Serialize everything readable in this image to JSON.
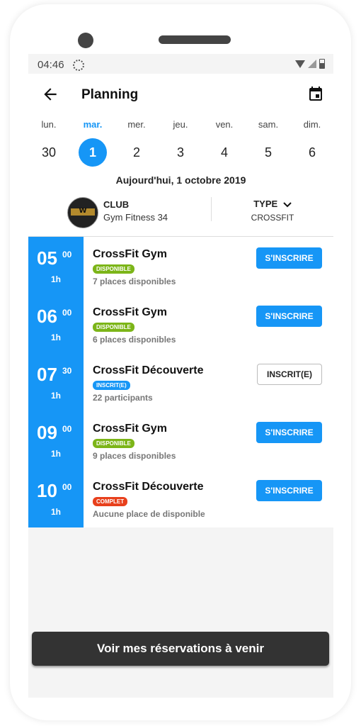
{
  "status": {
    "time": "04:46"
  },
  "header": {
    "title": "Planning"
  },
  "days": [
    {
      "label": "lun.",
      "num": "30",
      "active": false
    },
    {
      "label": "mar.",
      "num": "1",
      "active": true
    },
    {
      "label": "mer.",
      "num": "2",
      "active": false
    },
    {
      "label": "jeu.",
      "num": "3",
      "active": false
    },
    {
      "label": "ven.",
      "num": "4",
      "active": false
    },
    {
      "label": "sam.",
      "num": "5",
      "active": false
    },
    {
      "label": "dim.",
      "num": "6",
      "active": false
    }
  ],
  "date_line": "Aujourd'hui, 1 octobre 2019",
  "filters": {
    "club_label": "CLUB",
    "club_name": "Gym Fitness 34",
    "club_logo_text": "W",
    "type_label": "TYPE",
    "type_value": "CROSSFIT"
  },
  "sessions": [
    {
      "hour": "05",
      "minutes": "00",
      "duration": "1h",
      "title": "CrossFit Gym",
      "badge": "DISPONIBLE",
      "badge_color": "#7cb518",
      "sub": "7 places disponibles",
      "action": "S'INSCRIRE",
      "action_style": "primary"
    },
    {
      "hour": "06",
      "minutes": "00",
      "duration": "1h",
      "title": "CrossFit Gym",
      "badge": "DISPONIBLE",
      "badge_color": "#7cb518",
      "sub": "6 places disponibles",
      "action": "S'INSCRIRE",
      "action_style": "primary"
    },
    {
      "hour": "07",
      "minutes": "30",
      "duration": "1h",
      "title": "CrossFit Découverte",
      "badge": "INSCRIT(E)",
      "badge_color": "#1696f6",
      "sub": "22 participants",
      "action": "INSCRIT(E)",
      "action_style": "outline"
    },
    {
      "hour": "09",
      "minutes": "00",
      "duration": "1h",
      "title": "CrossFit Gym",
      "badge": "DISPONIBLE",
      "badge_color": "#7cb518",
      "sub": "9 places disponibles",
      "action": "S'INSCRIRE",
      "action_style": "primary"
    },
    {
      "hour": "10",
      "minutes": "00",
      "duration": "1h",
      "title": "CrossFit Découverte",
      "badge": "COMPLET",
      "badge_color": "#e8401c",
      "sub": "Aucune place de disponible",
      "action": "S'INSCRIRE",
      "action_style": "primary"
    }
  ],
  "footer": {
    "button_label": "Voir mes réservations à venir"
  },
  "colors": {
    "accent": "#1696f6",
    "dark_button": "#333333"
  }
}
